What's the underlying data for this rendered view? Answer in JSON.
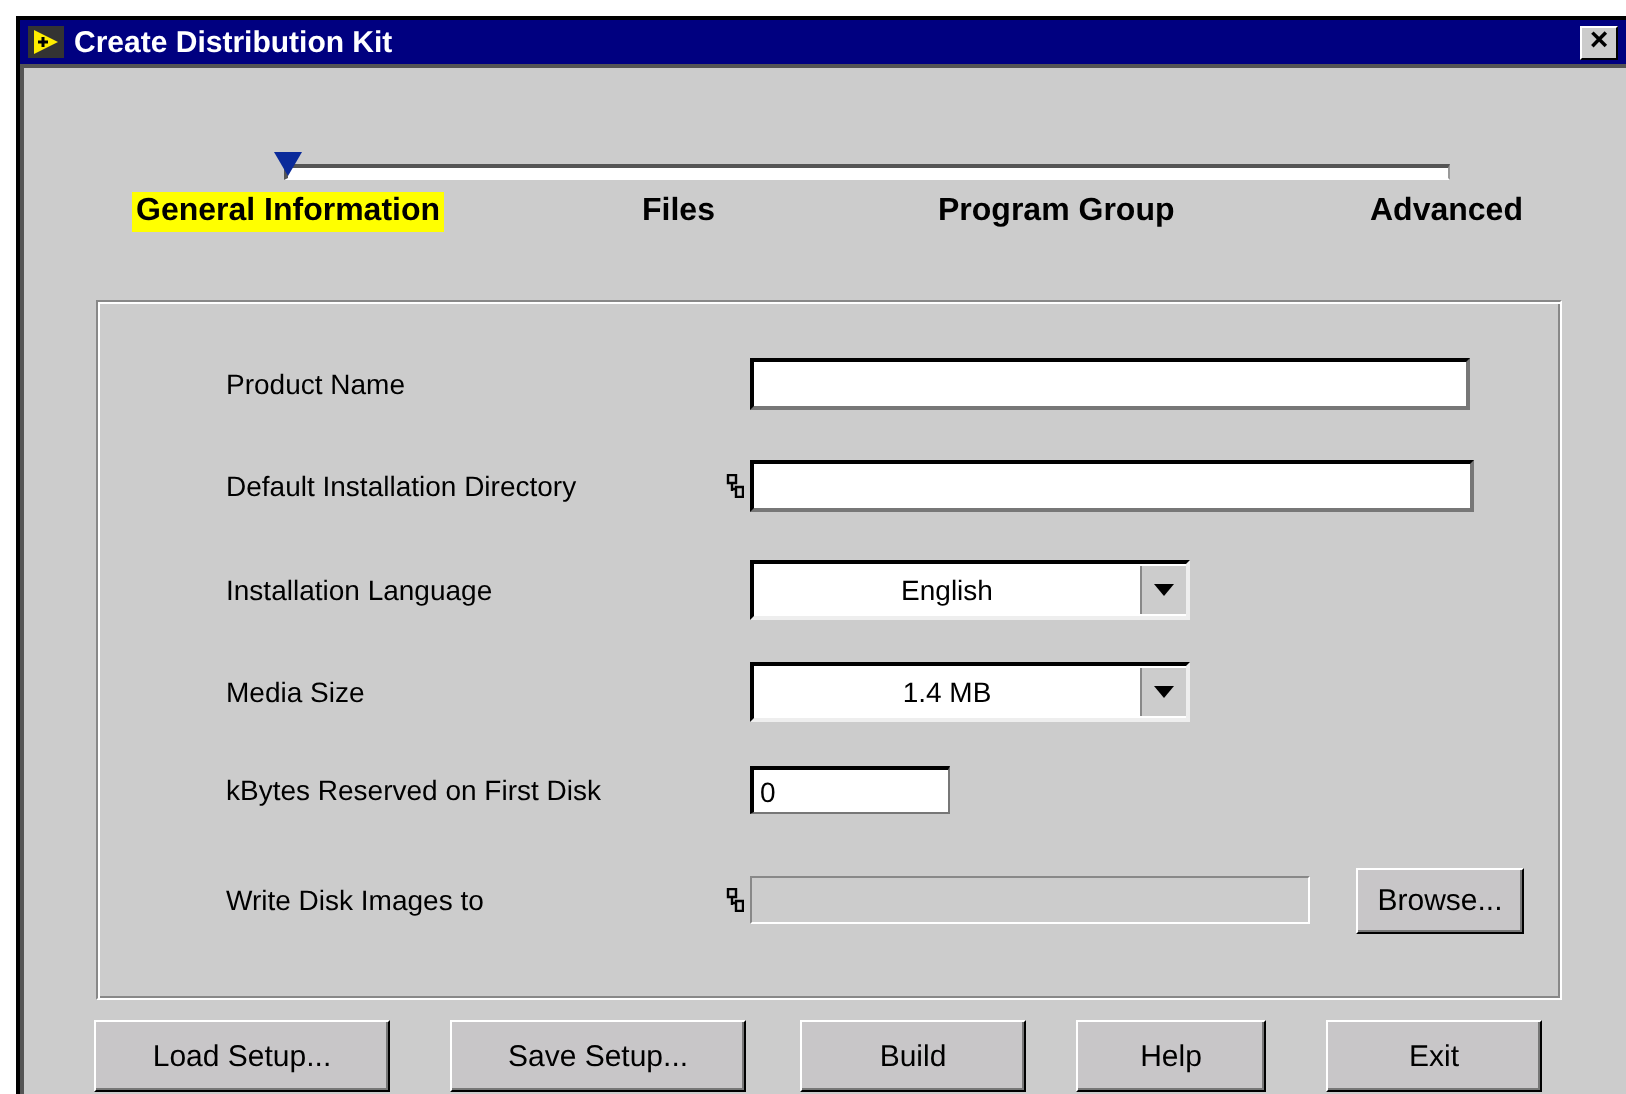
{
  "window": {
    "title": "Create Distribution Kit",
    "close": "×"
  },
  "steps": [
    {
      "label": "General Information",
      "selected": true
    },
    {
      "label": "Files",
      "selected": false
    },
    {
      "label": "Program Group",
      "selected": false
    },
    {
      "label": "Advanced",
      "selected": false
    }
  ],
  "fields": [
    {
      "kind": "text",
      "label": "Product Name"
    },
    {
      "kind": "path",
      "label": "Default Installation Directory",
      "disabled": false
    },
    {
      "kind": "dropdown",
      "label": "Installation Language",
      "value": "English"
    },
    {
      "kind": "dropdown",
      "label": "Media Size",
      "value": "1.4 MB"
    },
    {
      "kind": "number",
      "label": "kBytes Reserved on First Disk",
      "value": "0"
    },
    {
      "kind": "path",
      "label": "Write Disk Images to",
      "disabled": true,
      "button": "Browse..."
    }
  ],
  "buttons": [
    "Load Setup...",
    "Save Setup...",
    "Build",
    "Help",
    "Exit"
  ]
}
